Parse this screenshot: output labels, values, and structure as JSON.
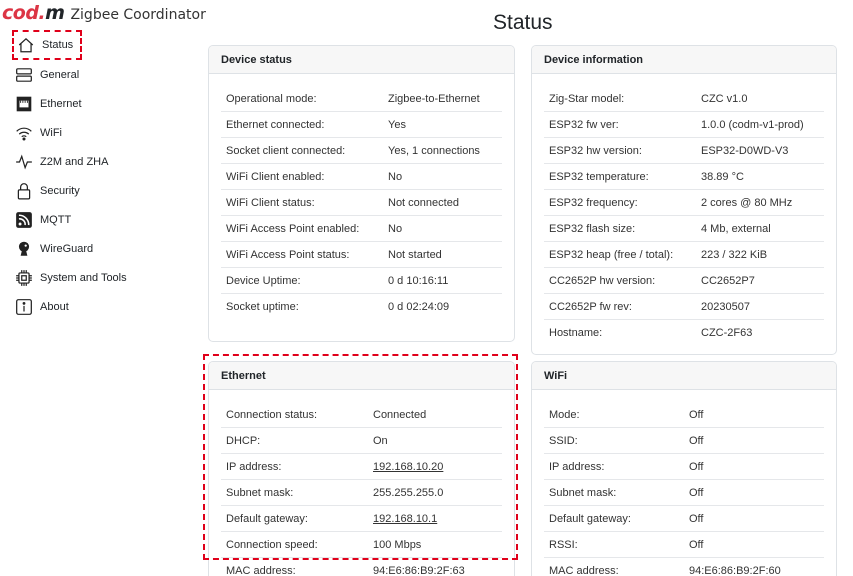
{
  "app": {
    "logo_cod": "cod",
    "logo_dot": ".",
    "logo_m": "m",
    "subtitle": "Zigbee Coordinator"
  },
  "colors": {
    "accent": "#dc3545",
    "highlight": "#e0001a"
  },
  "sidebar": {
    "items": [
      {
        "label": "Status",
        "icon": "house-icon"
      },
      {
        "label": "General",
        "icon": "server-icon"
      },
      {
        "label": "Ethernet",
        "icon": "ethernet-icon"
      },
      {
        "label": "WiFi",
        "icon": "wifi-icon"
      },
      {
        "label": "Z2M and ZHA",
        "icon": "activity-icon"
      },
      {
        "label": "Security",
        "icon": "lock-icon"
      },
      {
        "label": "MQTT",
        "icon": "rss-icon"
      },
      {
        "label": "WireGuard",
        "icon": "wireguard-icon"
      },
      {
        "label": "System and Tools",
        "icon": "cpu-icon"
      },
      {
        "label": "About",
        "icon": "info-icon"
      }
    ]
  },
  "page": {
    "title": "Status"
  },
  "device_status": {
    "title": "Device status",
    "rows": [
      {
        "k": "Operational mode:",
        "v": "Zigbee-to-Ethernet"
      },
      {
        "k": "Ethernet connected:",
        "v": "Yes"
      },
      {
        "k": "Socket client connected:",
        "v": "Yes, 1 connections"
      },
      {
        "k": "WiFi Client enabled:",
        "v": "No"
      },
      {
        "k": "WiFi Client status:",
        "v": "Not connected"
      },
      {
        "k": "WiFi Access Point enabled:",
        "v": "No"
      },
      {
        "k": "WiFi Access Point status:",
        "v": "Not started"
      },
      {
        "k": "Device Uptime:",
        "v": "0 d 10:16:11"
      },
      {
        "k": "Socket uptime:",
        "v": "0 d 02:24:09"
      }
    ]
  },
  "device_info": {
    "title": "Device information",
    "rows": [
      {
        "k": "Zig-Star model:",
        "v": "CZC v1.0"
      },
      {
        "k": "ESP32 fw ver:",
        "v": "1.0.0 (codm-v1-prod)"
      },
      {
        "k": "ESP32 hw version:",
        "v": "ESP32-D0WD-V3"
      },
      {
        "k": "ESP32 temperature:",
        "v": "38.89 °C"
      },
      {
        "k": "ESP32 frequency:",
        "v": "2 cores @ 80 MHz"
      },
      {
        "k": "ESP32 flash size:",
        "v": "4 Mb, external"
      },
      {
        "k": "ESP32 heap (free / total):",
        "v": "223 / 322 KiB"
      },
      {
        "k": "CC2652P hw version:",
        "v": "CC2652P7"
      },
      {
        "k": "CC2652P fw rev:",
        "v": "20230507"
      },
      {
        "k": "Hostname:",
        "v": "CZC-2F63"
      }
    ]
  },
  "ethernet": {
    "title": "Ethernet",
    "rows": [
      {
        "k": "Connection status:",
        "v": "Connected"
      },
      {
        "k": "DHCP:",
        "v": "On"
      },
      {
        "k": "IP address:",
        "v": "192.168.10.20"
      },
      {
        "k": "Subnet mask:",
        "v": "255.255.255.0"
      },
      {
        "k": "Default gateway:",
        "v": "192.168.10.1"
      },
      {
        "k": "Connection speed:",
        "v": "100 Mbps"
      },
      {
        "k": "MAC address:",
        "v": "94:E6:86:B9:2F:63"
      }
    ]
  },
  "wifi": {
    "title": "WiFi",
    "rows": [
      {
        "k": "Mode:",
        "v": "Off"
      },
      {
        "k": "SSID:",
        "v": "Off"
      },
      {
        "k": "IP address:",
        "v": "Off"
      },
      {
        "k": "Subnet mask:",
        "v": "Off"
      },
      {
        "k": "Default gateway:",
        "v": "Off"
      },
      {
        "k": "RSSI:",
        "v": "Off"
      },
      {
        "k": "MAC address:",
        "v": "94:E6:86:B9:2F:60"
      }
    ]
  }
}
